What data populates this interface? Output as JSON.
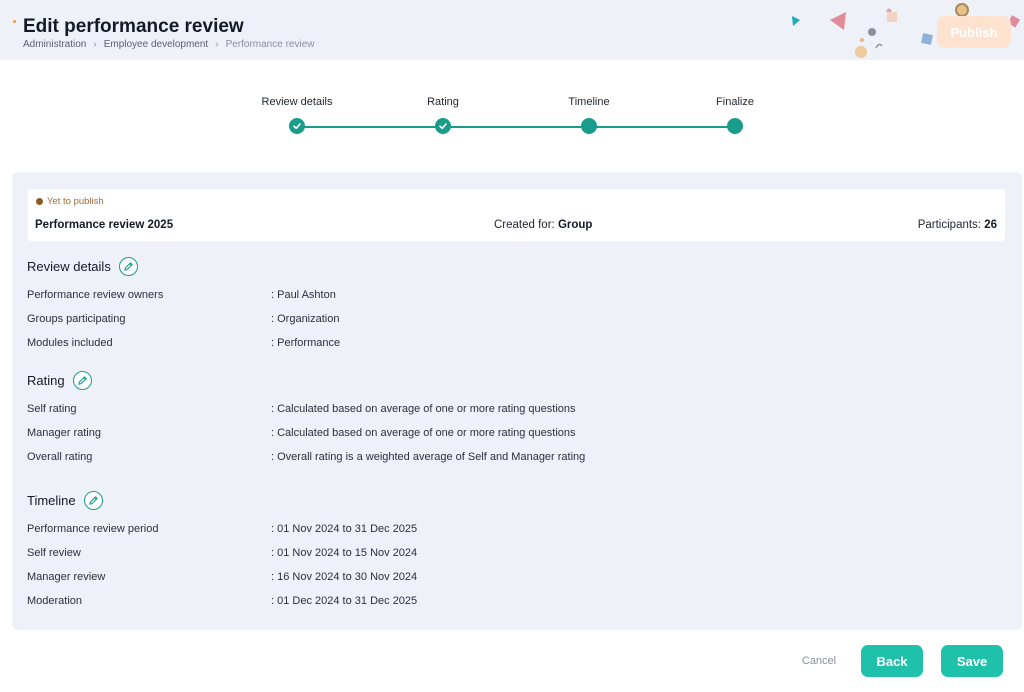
{
  "header": {
    "title": "Edit performance review",
    "breadcrumb": [
      "Administration",
      "Employee development",
      "Performance review"
    ],
    "publish_label": "Publish"
  },
  "stepper": {
    "steps": [
      {
        "label": "Review details",
        "state": "completed"
      },
      {
        "label": "Rating",
        "state": "completed"
      },
      {
        "label": "Timeline",
        "state": "current"
      },
      {
        "label": "Finalize",
        "state": "current"
      }
    ],
    "color": "#1a9c8a"
  },
  "summary": {
    "status": "Yet to publish",
    "name": "Performance review 2025",
    "created_for_label": "Created for:",
    "created_for_value": "Group",
    "participants_label": "Participants:",
    "participants_value": "26"
  },
  "sections": {
    "review_details": {
      "title": "Review details",
      "rows": [
        {
          "label": "Performance review owners",
          "value": ": Paul Ashton"
        },
        {
          "label": "Groups participating",
          "value": ": Organization"
        },
        {
          "label": "Modules included",
          "value": ": Performance"
        }
      ]
    },
    "rating": {
      "title": "Rating",
      "rows": [
        {
          "label": "Self rating",
          "value": ": Calculated based on average of one or more rating questions"
        },
        {
          "label": "Manager rating",
          "value": ": Calculated based on average of one or more rating questions"
        },
        {
          "label": "Overall rating",
          "value": ": Overall rating is a weighted average of Self and Manager rating"
        }
      ]
    },
    "timeline": {
      "title": "Timeline",
      "rows": [
        {
          "label": "Performance review period",
          "value": ": 01 Nov 2024 to 31 Dec 2025"
        },
        {
          "label": "Self review",
          "value": ": 01 Nov 2024 to 15 Nov 2024"
        },
        {
          "label": "Manager review",
          "value": ": 16 Nov 2024 to 30 Nov 2024"
        },
        {
          "label": "Moderation",
          "value": ": 01 Dec 2024 to 31 Dec 2025"
        }
      ]
    }
  },
  "footer": {
    "cancel_label": "Cancel",
    "back_label": "Back",
    "save_label": "Save"
  },
  "colors": {
    "accent": "#1a9c8a",
    "button": "#1fc1aa",
    "publish_disabled": "#fde3cf",
    "status_dot": "#8b5a2b"
  },
  "icons": {
    "step_done": "check-icon",
    "edit": "pencil-icon",
    "breadcrumb_sep": "chevron-right-icon"
  }
}
